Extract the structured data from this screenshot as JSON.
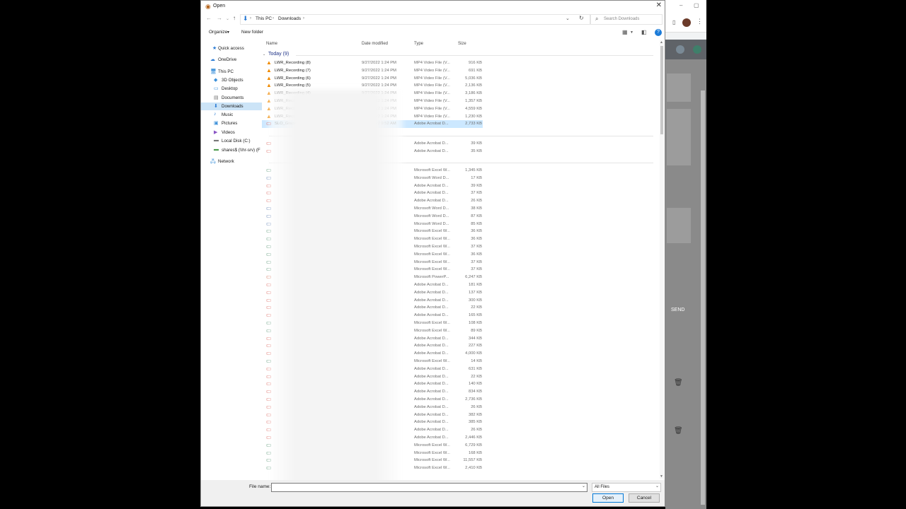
{
  "dialog": {
    "title": "Open"
  },
  "address": {
    "crumbs": [
      "This PC",
      "Downloads"
    ],
    "search_placeholder": "Search Downloads"
  },
  "toolbar": {
    "organize": "Organize",
    "new_folder": "New folder"
  },
  "nav": [
    {
      "label": "Quick access",
      "icon": "star-icon"
    },
    {
      "label": "OneDrive",
      "icon": "cloud-icon"
    },
    {
      "label": "This PC",
      "icon": "computer-icon"
    },
    {
      "label": "3D Objects",
      "icon": "cube-icon"
    },
    {
      "label": "Desktop",
      "icon": "desktop-icon"
    },
    {
      "label": "Documents",
      "icon": "documents-icon"
    },
    {
      "label": "Downloads",
      "icon": "download-arrow-icon",
      "selected": true
    },
    {
      "label": "Music",
      "icon": "music-icon"
    },
    {
      "label": "Pictures",
      "icon": "pictures-icon"
    },
    {
      "label": "Videos",
      "icon": "videos-icon"
    },
    {
      "label": "Local Disk (C:)",
      "icon": "drive-icon"
    },
    {
      "label": "shares$ (\\\\hr-srv) (F",
      "icon": "network-drive-icon"
    },
    {
      "label": "Network",
      "icon": "network-icon"
    }
  ],
  "columns": {
    "name": "Name",
    "date": "Date modified",
    "type": "Type",
    "size": "Size"
  },
  "groups": [
    {
      "label": "Today (9)"
    }
  ],
  "files": [
    {
      "name": "LWR_Recording (8)",
      "date": "9/27/2022 1:24 PM",
      "type": "MP4 Video File (V...",
      "size": "916 KB"
    },
    {
      "name": "LWR_Recording (7)",
      "date": "9/27/2022 1:24 PM",
      "type": "MP4 Video File (V...",
      "size": "691 KB"
    },
    {
      "name": "LWR_Recording (6)",
      "date": "9/27/2022 1:24 PM",
      "type": "MP4 Video File (V...",
      "size": "5,036 KB"
    },
    {
      "name": "LWR_Recording (5)",
      "date": "9/27/2022 1:24 PM",
      "type": "MP4 Video File (V...",
      "size": "2,136 KB"
    },
    {
      "name": "LWR_Recording (4)",
      "date": "9/27/2022 1:24 PM",
      "type": "MP4 Video File (V...",
      "size": "3,186 KB"
    },
    {
      "name": "LWR_Recording (3)",
      "date": "9/27/2022 1:24 PM",
      "type": "MP4 Video File (V...",
      "size": "1,357 KB"
    },
    {
      "name": "LWR_Recording (2)",
      "date": "9/27/2022 1:24 PM",
      "type": "MP4 Video File (V...",
      "size": "4,559 KB"
    },
    {
      "name": "LWR_Recording (1)",
      "date": "9/27/2022 1:24 PM",
      "type": "MP4 Video File (V...",
      "size": "1,230 KB"
    },
    {
      "name": "SLO_Grade_2_Math",
      "date": "9/27/2022 9:52 AM",
      "type": "Adobe Acrobat D...",
      "size": "2,733 KB",
      "selected": true
    }
  ],
  "other_rows": [
    {
      "type": "Adobe Acrobat D...",
      "size": "39 KB"
    },
    {
      "type": "Adobe Acrobat D...",
      "size": "35 KB"
    },
    {
      "type": "Microsoft Excel W...",
      "size": "1,345 KB"
    },
    {
      "type": "Microsoft Word D...",
      "size": "17 KB"
    },
    {
      "type": "Adobe Acrobat D...",
      "size": "39 KB"
    },
    {
      "type": "Adobe Acrobat D...",
      "size": "37 KB"
    },
    {
      "type": "Adobe Acrobat D...",
      "size": "26 KB"
    },
    {
      "type": "Microsoft Word D...",
      "size": "38 KB"
    },
    {
      "type": "Microsoft Word D...",
      "size": "87 KB"
    },
    {
      "type": "Microsoft Word D...",
      "size": "85 KB"
    },
    {
      "type": "Microsoft Excel W...",
      "size": "36 KB"
    },
    {
      "type": "Microsoft Excel W...",
      "size": "36 KB"
    },
    {
      "type": "Microsoft Excel W...",
      "size": "37 KB"
    },
    {
      "type": "Microsoft Excel W...",
      "size": "36 KB"
    },
    {
      "type": "Microsoft Excel W...",
      "size": "37 KB"
    },
    {
      "type": "Microsoft Excel W...",
      "size": "37 KB"
    },
    {
      "type": "Microsoft PowerP...",
      "size": "6,247 KB"
    },
    {
      "type": "Adobe Acrobat D...",
      "size": "181 KB"
    },
    {
      "type": "Adobe Acrobat D...",
      "size": "137 KB"
    },
    {
      "type": "Adobe Acrobat D...",
      "size": "300 KB"
    },
    {
      "type": "Adobe Acrobat D...",
      "size": "22 KB"
    },
    {
      "type": "Adobe Acrobat D...",
      "size": "165 KB"
    },
    {
      "type": "Microsoft Excel W...",
      "size": "108 KB"
    },
    {
      "type": "Microsoft Excel W...",
      "size": "89 KB"
    },
    {
      "type": "Adobe Acrobat D...",
      "size": "344 KB"
    },
    {
      "type": "Adobe Acrobat D...",
      "size": "227 KB"
    },
    {
      "type": "Adobe Acrobat D...",
      "size": "4,000 KB"
    },
    {
      "type": "Microsoft Excel W...",
      "size": "14 KB"
    },
    {
      "type": "Adobe Acrobat D...",
      "size": "631 KB"
    },
    {
      "type": "Adobe Acrobat D...",
      "size": "22 KB"
    },
    {
      "type": "Adobe Acrobat D...",
      "size": "140 KB"
    },
    {
      "type": "Adobe Acrobat D...",
      "size": "834 KB"
    },
    {
      "type": "Adobe Acrobat D...",
      "size": "2,736 KB"
    },
    {
      "type": "Adobe Acrobat D...",
      "size": "26 KB"
    },
    {
      "type": "Adobe Acrobat D...",
      "size": "382 KB"
    },
    {
      "type": "Adobe Acrobat D...",
      "size": "385 KB"
    },
    {
      "type": "Adobe Acrobat D...",
      "size": "26 KB"
    },
    {
      "type": "Adobe Acrobat D...",
      "size": "2,446 KB"
    },
    {
      "type": "Microsoft Excel W...",
      "size": "6,729 KB"
    },
    {
      "type": "Microsoft Excel W...",
      "size": "168 KB"
    },
    {
      "type": "Microsoft Excel W...",
      "size": "11,557 KB"
    },
    {
      "type": "Microsoft Excel W...",
      "size": "2,410 KB"
    }
  ],
  "bottom": {
    "file_name_label": "File name:",
    "file_name_value": "",
    "filter": "All Files",
    "open": "Open",
    "cancel": "Cancel"
  },
  "background": {
    "send_label": "SEND"
  },
  "colors": {
    "selection": "#cce8ff",
    "accent": "#0078d7",
    "group_header": "#1e3287"
  }
}
